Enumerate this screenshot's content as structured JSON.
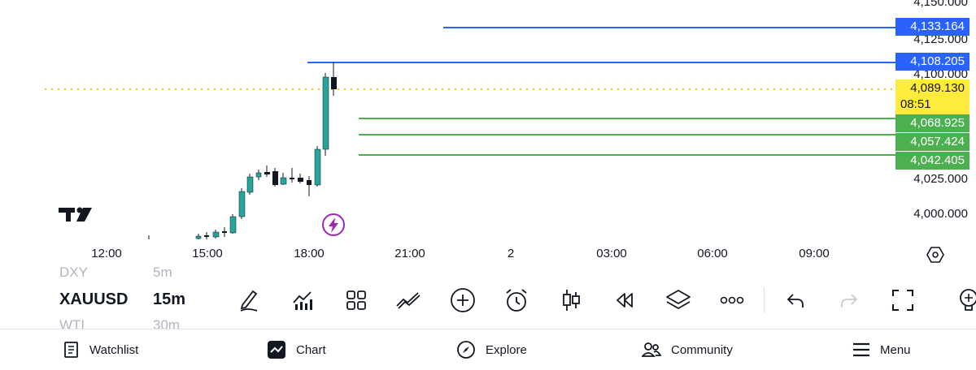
{
  "symbol": {
    "current": "XAUUSD",
    "interval": "15m",
    "prev_symbol": "DXY",
    "prev_interval": "5m",
    "next_symbol": "WTI",
    "next_interval": "30m"
  },
  "price_axis": [
    "4,150.000",
    "4,125.000",
    "4,100.000",
    "4,025.000",
    "4,000.000"
  ],
  "price_tags": {
    "blue_top": "4,133.164",
    "blue_mid": "4,108.205",
    "current_price": "4,089.130",
    "countdown": "08:51",
    "green_1": "4,068.925",
    "green_2": "4,057.424",
    "green_3": "4,042.405"
  },
  "time_axis": [
    "12:00",
    "15:00",
    "18:00",
    "21:00",
    "2",
    "03:00",
    "06:00",
    "09:00"
  ],
  "colors": {
    "bull": "#26a69a",
    "bear": "#131722",
    "blue_line": "#2962ff",
    "green_line": "#4caf50",
    "current_price": "#ffeb3b",
    "lightning": "#9c27b0"
  },
  "toolbar_icons": [
    "pencil-icon",
    "indicators-icon",
    "grid-layout-icon",
    "compare-icon",
    "add-icon",
    "alarm-icon",
    "candle-type-icon",
    "replay-icon",
    "layers-icon",
    "more-icon",
    "undo-icon",
    "redo-icon",
    "fullscreen-icon",
    "lightbulb-icon"
  ],
  "nav": {
    "watchlist": "Watchlist",
    "chart": "Chart",
    "explore": "Explore",
    "community": "Community",
    "menu": "Menu"
  }
}
